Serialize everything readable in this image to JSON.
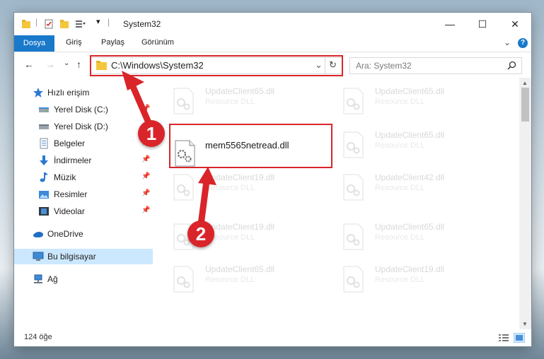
{
  "window": {
    "title": "System32"
  },
  "ribbon": {
    "tabs": [
      "Dosya",
      "Giriş",
      "Paylaş",
      "Görünüm"
    ]
  },
  "address": {
    "path": "C:\\Windows\\System32"
  },
  "search": {
    "placeholder": "Ara: System32"
  },
  "sidebar": {
    "items": [
      {
        "label": "Hızlı erişim",
        "icon": "star-icon"
      },
      {
        "label": "Yerel Disk (C:)",
        "icon": "drive-icon"
      },
      {
        "label": "Yerel Disk (D:)",
        "icon": "drive-icon"
      },
      {
        "label": "Belgeler",
        "icon": "documents-icon"
      },
      {
        "label": "İndirmeler",
        "icon": "download-icon"
      },
      {
        "label": "Müzik",
        "icon": "music-icon"
      },
      {
        "label": "Resimler",
        "icon": "pictures-icon"
      },
      {
        "label": "Videolar",
        "icon": "video-icon"
      },
      {
        "label": "OneDrive",
        "icon": "cloud-icon"
      },
      {
        "label": "Bu bilgisayar",
        "icon": "computer-icon"
      },
      {
        "label": "Ağ",
        "icon": "network-icon"
      }
    ]
  },
  "files": {
    "highlighted": {
      "name": "mem5565netread.dll"
    },
    "ghost_type": "Resource DLL",
    "ghost_left": [
      "UpdateClient65.dll",
      "",
      "UpdateClient19.dll",
      "UpdateClient19.dll",
      "UpdateClient65.dll"
    ],
    "ghost_right": [
      "UpdateClient65.dll",
      "UpdateClient65.dll",
      "UpdateClient42.dll",
      "UpdateClient65.dll",
      "UpdateClient19.dll"
    ]
  },
  "status": {
    "count": "124 öğe"
  },
  "annotations": {
    "step1": "1",
    "step2": "2"
  },
  "colors": {
    "accent": "#1979ca",
    "highlight": "#d9252a",
    "selection": "#cce8ff"
  }
}
